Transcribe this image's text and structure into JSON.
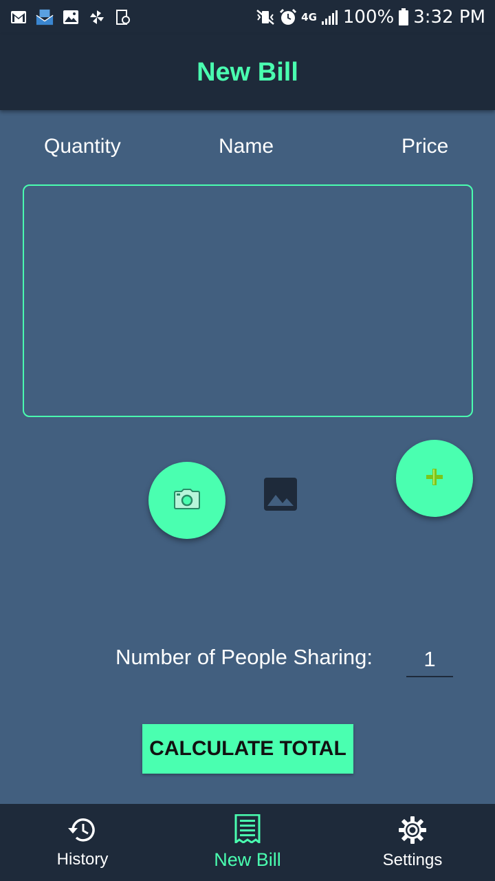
{
  "status_bar": {
    "battery": "100%",
    "time": "3:32 PM",
    "network": "4G"
  },
  "app_bar": {
    "title": "New Bill"
  },
  "columns": {
    "quantity": "Quantity",
    "name": "Name",
    "price": "Price"
  },
  "fabs": {
    "camera_icon": "camera-icon",
    "gallery_icon": "image-icon",
    "add_label": "+"
  },
  "people": {
    "label": "Number of People Sharing:",
    "value": "1"
  },
  "calculate": {
    "label": "CALCULATE TOTAL"
  },
  "bottom_nav": {
    "items": [
      {
        "label": "History",
        "icon": "history-icon",
        "active": false
      },
      {
        "label": "New Bill",
        "icon": "receipt-icon",
        "active": true
      },
      {
        "label": "Settings",
        "icon": "gear-icon",
        "active": false
      }
    ]
  },
  "colors": {
    "accent": "#4affb0",
    "background": "#425f7f",
    "bar": "#1e2a3a"
  }
}
